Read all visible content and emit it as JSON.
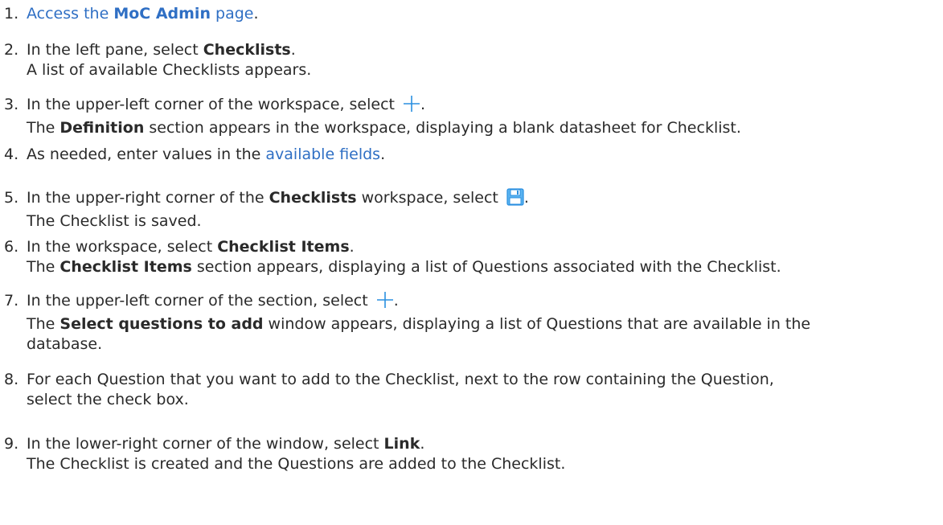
{
  "steps": [
    {
      "num": "1.",
      "p1": "Access the ",
      "b1": "MoC Admin",
      "p2": " page",
      "end": "."
    },
    {
      "num": "2.",
      "p1": "In the left pane, select ",
      "b1": "Checklists",
      "end": ".",
      "result": "A list of available Checklists appears."
    },
    {
      "num": "3.",
      "p1": "In the upper-left corner of the workspace, select ",
      "icon": "plus-icon",
      "end": ".",
      "result_p1": "The ",
      "result_b1": "Definition",
      "result_p2": " section appears in the workspace, displaying a blank datasheet for Checklist."
    },
    {
      "num": "4.",
      "p1": "As needed, enter values in the ",
      "link": "available fields",
      "end": "."
    },
    {
      "num": "5.",
      "p1": "In the upper-right corner of the ",
      "b1": "Checklists",
      "p2": " workspace, select ",
      "icon": "save-icon",
      "end": ".",
      "result": "The Checklist is saved."
    },
    {
      "num": "6.",
      "p1": "In the workspace, select ",
      "b1": "Checklist Items",
      "end": ".",
      "result_p1": "The ",
      "result_b1": "Checklist Items",
      "result_p2": " section appears, displaying a list of Questions associated with the Checklist."
    },
    {
      "num": "7.",
      "p1": "In the upper-left corner of the section, select ",
      "icon": "plus-icon",
      "end": ".",
      "result_p1": "The ",
      "result_b1": "Select questions to add",
      "result_p2": " window appears, displaying a list of Questions that are available in the",
      "result_line2": "database."
    },
    {
      "num": "8.",
      "p1": "For each Question that you want to add to the Checklist, next to the row containing the Question,",
      "line2": "select the check box."
    },
    {
      "num": "9.",
      "p1": "In the lower-right corner of the window, select ",
      "b1": "Link",
      "end": ".",
      "result": "The Checklist is created and the Questions are added to the Checklist."
    }
  ],
  "colors": {
    "link": "#2f6fc4",
    "icon_blue": "#2a8fe0",
    "text": "#2a2a2a"
  }
}
